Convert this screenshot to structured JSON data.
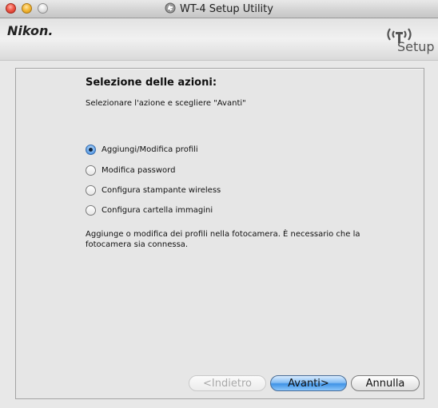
{
  "window": {
    "title": "WT-4 Setup Utility"
  },
  "header": {
    "brand": "Nikon.",
    "setup_logo_text": "Setup"
  },
  "page": {
    "heading": "Selezione delle azioni:",
    "instruction": "Selezionare l'azione e scegliere \"Avanti\"",
    "options": [
      {
        "label": "Aggiungi/Modifica profili",
        "selected": true
      },
      {
        "label": "Modifica password",
        "selected": false
      },
      {
        "label": "Configura stampante wireless",
        "selected": false
      },
      {
        "label": "Configura cartella immagini",
        "selected": false
      }
    ],
    "description": "Aggiunge o modifica dei profili nella fotocamera. È necessario che la fotocamera sia connessa."
  },
  "buttons": {
    "back": "<Indietro",
    "next": "Avanti>",
    "cancel": "Annulla"
  },
  "colors": {
    "default_button": "#3f93e6",
    "disabled_text": "#a9a9a9",
    "panel": "#e6e6e6"
  },
  "icons": {
    "window_controls": [
      "close-icon",
      "minimize-icon",
      "zoom-icon"
    ],
    "title_icon": "wireless-app-icon",
    "setup_logo": "wireless-antenna-icon"
  }
}
